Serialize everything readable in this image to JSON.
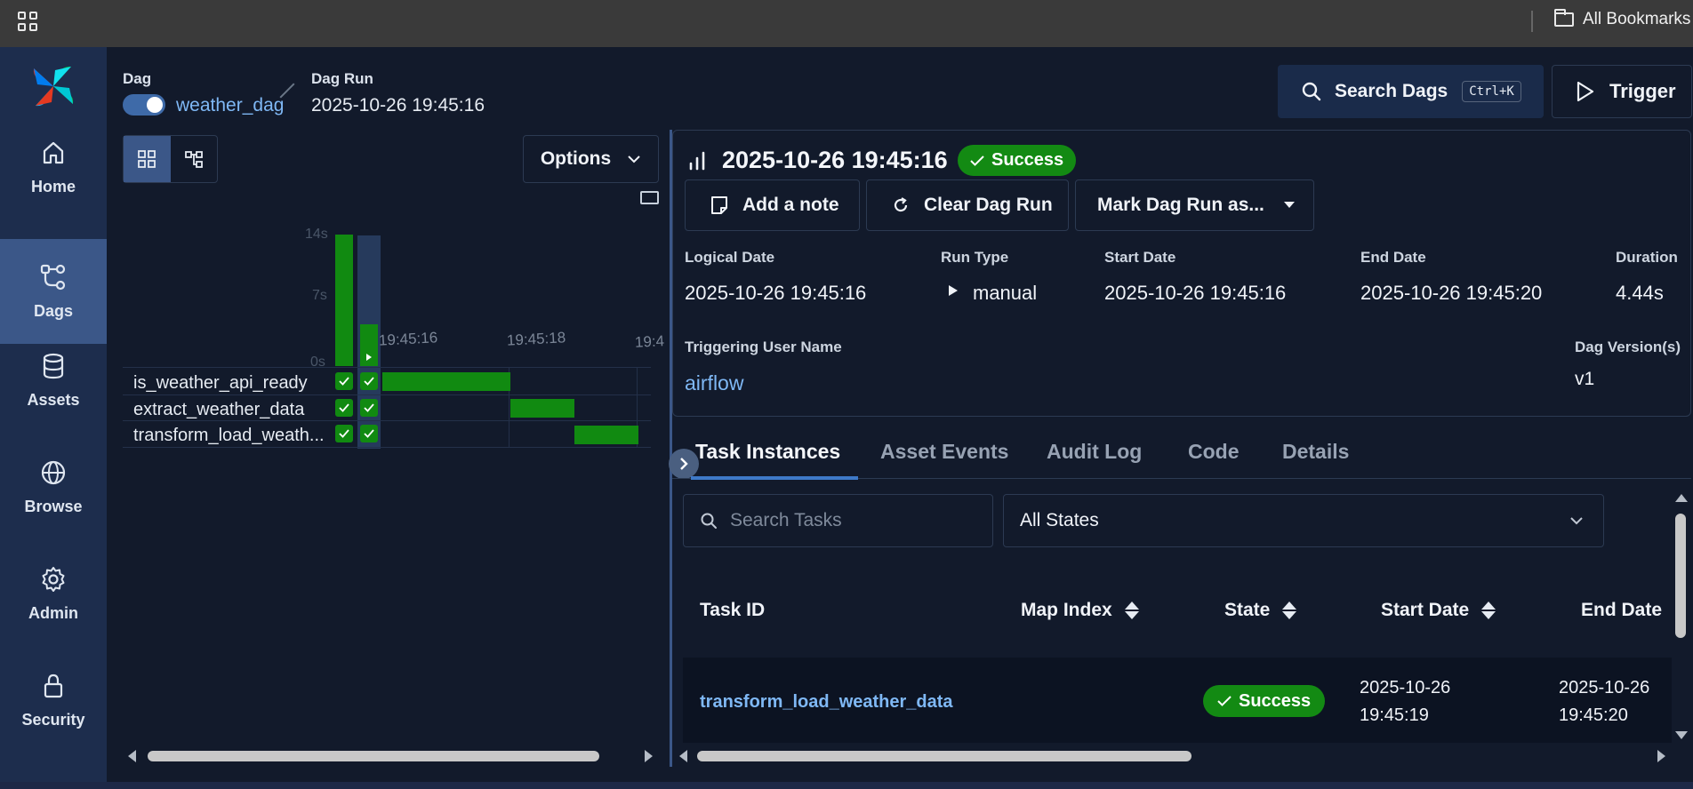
{
  "browser": {
    "bookmarks_label": "All Bookmarks"
  },
  "nav": {
    "items": [
      {
        "label": "Home",
        "icon": "home-icon"
      },
      {
        "label": "Dags",
        "icon": "dags-icon",
        "active": true
      },
      {
        "label": "Assets",
        "icon": "database-icon"
      },
      {
        "label": "Browse",
        "icon": "globe-icon"
      },
      {
        "label": "Admin",
        "icon": "gear-icon"
      },
      {
        "label": "Security",
        "icon": "lock-icon"
      }
    ]
  },
  "breadcrumb": {
    "dag_label": "Dag",
    "dag_name": "weather_dag",
    "run_label": "Dag Run",
    "run_value": "2025-10-26 19:45:16"
  },
  "header": {
    "search_label": "Search Dags",
    "search_shortcut": "Ctrl+K",
    "trigger_label": "Trigger"
  },
  "grid": {
    "options_label": "Options",
    "duration_axis": [
      "14s",
      "7s",
      "0s"
    ],
    "time_ticks": [
      "19:45:16",
      "19:45:18",
      "19:4"
    ],
    "runs": [
      {
        "duration_s": 14,
        "state": "success"
      },
      {
        "duration_s": 4.44,
        "state": "success",
        "selected": true
      }
    ],
    "tasks": [
      {
        "name": "is_weather_api_ready",
        "start_s": 0.0,
        "end_s": 2.0
      },
      {
        "name": "extract_weather_data",
        "start_s": 2.0,
        "end_s": 3.0
      },
      {
        "name": "transform_load_weath...",
        "start_s": 3.0,
        "end_s": 4.0
      }
    ]
  },
  "run": {
    "title": "2025-10-26 19:45:16",
    "state": "Success",
    "actions": {
      "add_note": "Add a note",
      "clear": "Clear Dag Run",
      "mark": "Mark Dag Run as..."
    },
    "fields": {
      "logical_date_label": "Logical Date",
      "logical_date": "2025-10-26 19:45:16",
      "run_type_label": "Run Type",
      "run_type": "manual",
      "start_date_label": "Start Date",
      "start_date": "2025-10-26 19:45:16",
      "end_date_label": "End Date",
      "end_date": "2025-10-26 19:45:20",
      "duration_label": "Duration",
      "duration": "4.44s",
      "triggering_user_label": "Triggering User Name",
      "triggering_user": "airflow",
      "dag_version_label": "Dag Version(s)",
      "dag_version": "v1"
    }
  },
  "tabs": [
    "Task Instances",
    "Asset Events",
    "Audit Log",
    "Code",
    "Details"
  ],
  "filters": {
    "search_placeholder": "Search Tasks",
    "state_value": "All States"
  },
  "table": {
    "headers": [
      "Task ID",
      "Map Index",
      "State",
      "Start Date",
      "End Date"
    ],
    "rows": [
      {
        "task_id": "transform_load_weather_data",
        "state": "Success",
        "start_date_line1": "2025-10-26",
        "start_date_line2": "19:45:19",
        "end_date_line1": "2025-10-26",
        "end_date_line2": "19:45:20"
      }
    ]
  },
  "colors": {
    "success": "#138a13",
    "accent": "#3e79c8",
    "link": "#7fb8f5",
    "nav_bg": "#1d2d4d",
    "nav_active": "#3b5788"
  }
}
